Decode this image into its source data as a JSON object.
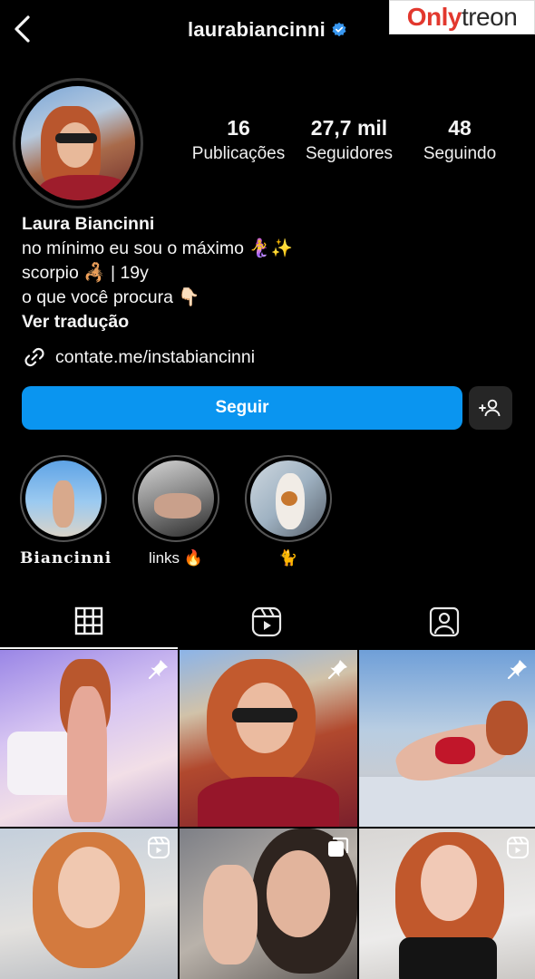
{
  "header": {
    "username": "laurabiancinni",
    "verified": true,
    "back_icon": "chevron-left-icon"
  },
  "watermark": {
    "part1": "Only",
    "part2": "treon"
  },
  "profile": {
    "stats": [
      {
        "value": "16",
        "label": "Publicações"
      },
      {
        "value": "27,7 mil",
        "label": "Seguidores"
      },
      {
        "value": "48",
        "label": "Seguindo"
      }
    ],
    "name": "Laura Biancinni",
    "bio_lines": [
      "no mínimo eu sou o máximo 🧜‍♀️✨",
      "scorpio 🦂 | 19y",
      "o que você procura 👇🏻"
    ],
    "translate_label": "Ver tradução",
    "link": "contate.me/instabiancinni"
  },
  "actions": {
    "follow_label": "Seguir",
    "suggest_icon": "add-person-icon"
  },
  "highlights": [
    {
      "label": "𝐁𝐢𝐚𝐧𝐜𝐢𝐧𝐧𝐢"
    },
    {
      "label": "links 🔥"
    },
    {
      "label": "🐈"
    }
  ],
  "tabs": [
    {
      "name": "grid",
      "icon": "grid-icon",
      "active": true
    },
    {
      "name": "reels",
      "icon": "reels-icon",
      "active": false
    },
    {
      "name": "tagged",
      "icon": "tagged-icon",
      "active": false
    }
  ],
  "posts": [
    {
      "badge": "pin-icon"
    },
    {
      "badge": "pin-icon"
    },
    {
      "badge": "pin-icon"
    },
    {
      "badge": "reels-icon"
    },
    {
      "badge": "carousel-icon"
    },
    {
      "badge": "reels-icon"
    }
  ],
  "colors": {
    "background": "#000000",
    "accent_blue": "#0a95f0",
    "verified_blue": "#3897f0",
    "secondary_button": "#262626",
    "watermark_red": "#e2382e"
  }
}
